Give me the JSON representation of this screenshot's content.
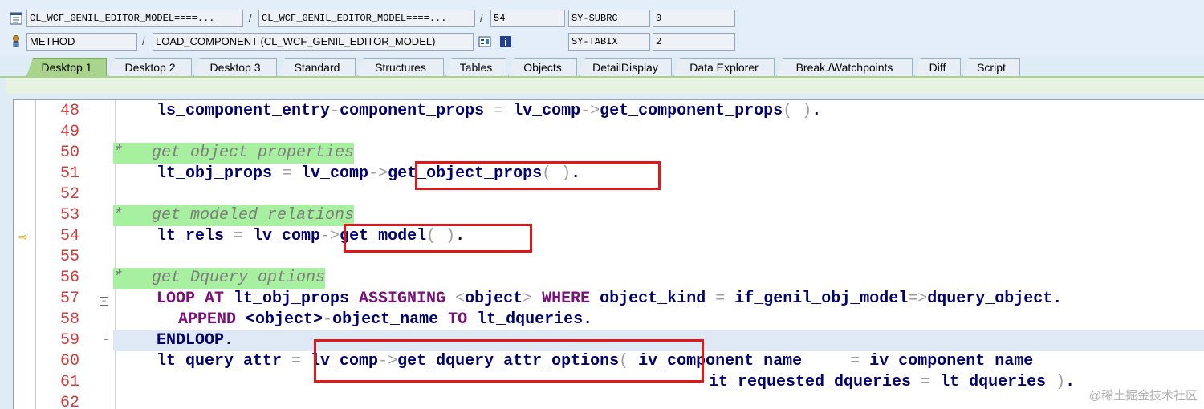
{
  "header": {
    "row1": {
      "program": "CL_WCF_GENIL_EDITOR_MODEL====...",
      "include": "CL_WCF_GENIL_EDITOR_MODEL====...",
      "line": "54",
      "var_name": "SY-SUBRC",
      "var_value": "0"
    },
    "row2": {
      "type": "METHOD",
      "event": "LOAD_COMPONENT (CL_WCF_GENIL_EDITOR_MODEL)",
      "var_name": "SY-TABIX",
      "var_value": "2"
    },
    "separator": "/"
  },
  "tabs": [
    {
      "label": "Desktop 1",
      "active": true
    },
    {
      "label": "Desktop 2"
    },
    {
      "label": "Desktop 3"
    },
    {
      "label": "Standard"
    },
    {
      "label": "Structures"
    },
    {
      "label": "Tables"
    },
    {
      "label": "Objects"
    },
    {
      "label": "DetailDisplay"
    },
    {
      "label": "Data Explorer"
    },
    {
      "label": "Break./Watchpoints"
    },
    {
      "label": "Diff"
    },
    {
      "label": "Script"
    }
  ],
  "editor": {
    "current_line": "54",
    "lines": [
      {
        "num": "48",
        "code": "ls_component_entry-component_props = lv_comp->get_component_props( )."
      },
      {
        "num": "49",
        "code": ""
      },
      {
        "num": "50",
        "code": "*   get object properties"
      },
      {
        "num": "51",
        "code": "lt_obj_props = lv_comp->get_object_props( )."
      },
      {
        "num": "52",
        "code": ""
      },
      {
        "num": "53",
        "code": "*   get modeled relations"
      },
      {
        "num": "54",
        "code": "lt_rels = lv_comp->get_model( )."
      },
      {
        "num": "55",
        "code": ""
      },
      {
        "num": "56",
        "code": "*   get Dquery options"
      },
      {
        "num": "57",
        "code": "LOOP AT lt_obj_props ASSIGNING <object> WHERE object_kind = if_genil_obj_model=>dquery_object."
      },
      {
        "num": "58",
        "code": "APPEND <object>-object_name TO lt_dqueries."
      },
      {
        "num": "59",
        "code": "ENDLOOP."
      },
      {
        "num": "60",
        "code": "lt_query_attr = lv_comp->get_dquery_attr_options( iv_component_name     = iv_component_name"
      },
      {
        "num": "61",
        "code": "it_requested_dqueries = lt_dqueries )."
      },
      {
        "num": "62",
        "code": ""
      }
    ]
  },
  "watermark": "@稀土掘金技术社区"
}
